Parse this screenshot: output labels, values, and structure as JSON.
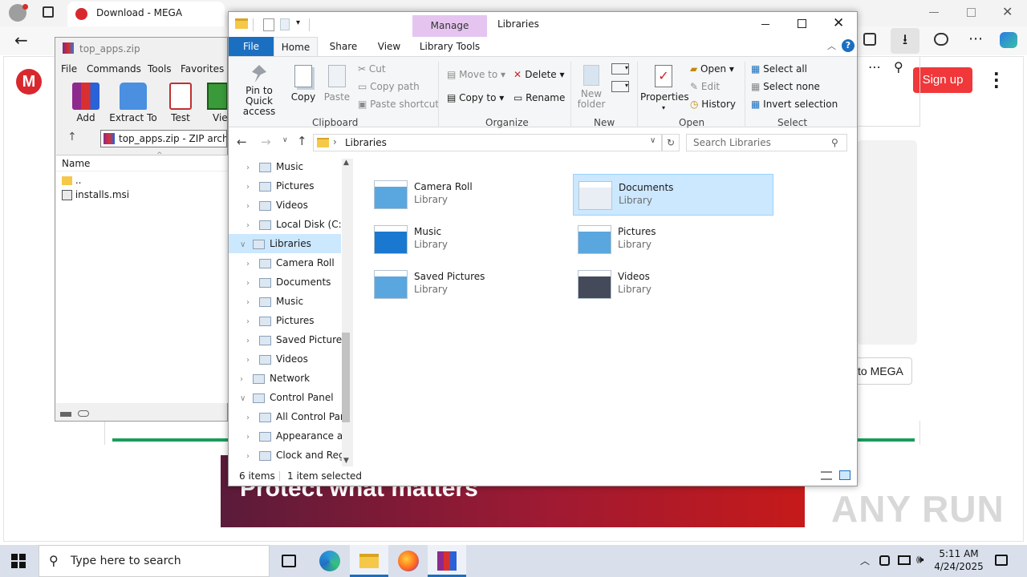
{
  "browser": {
    "tab_title": "Download - MEGA",
    "signup_label": "Sign up",
    "download_to_mega_label": "to MEGA",
    "banner_text": "Protect what matters"
  },
  "winrar": {
    "title": "top_apps.zip",
    "menu": [
      "File",
      "Commands",
      "Tools",
      "Favorites"
    ],
    "toolbar": [
      "Add",
      "Extract To",
      "Test",
      "View"
    ],
    "path": "top_apps.zip - ZIP archive",
    "column_name": "Name",
    "files": [
      "..",
      "installs.msi"
    ]
  },
  "explorer": {
    "title": "Libraries",
    "manage_label": "Manage",
    "tabs": [
      "File",
      "Home",
      "Share",
      "View",
      "Library Tools"
    ],
    "ribbon": {
      "clipboard": {
        "label": "Clipboard",
        "pin_label": "Pin to Quick access",
        "copy_label": "Copy",
        "paste_label": "Paste",
        "cut_label": "Cut",
        "copy_path_label": "Copy path",
        "paste_shortcut_label": "Paste shortcut"
      },
      "organize": {
        "label": "Organize",
        "move_to_label": "Move to",
        "copy_to_label": "Copy to",
        "delete_label": "Delete",
        "rename_label": "Rename"
      },
      "new": {
        "label": "New",
        "new_folder_label": "New folder"
      },
      "open": {
        "label": "Open",
        "properties_label": "Properties",
        "open_label": "Open",
        "edit_label": "Edit",
        "history_label": "History"
      },
      "select": {
        "label": "Select",
        "select_all_label": "Select all",
        "select_none_label": "Select none",
        "invert_label": "Invert selection"
      }
    },
    "address": "Libraries",
    "search_placeholder": "Search Libraries",
    "nav": [
      {
        "label": "Music",
        "indent": 2
      },
      {
        "label": "Pictures",
        "indent": 2
      },
      {
        "label": "Videos",
        "indent": 2
      },
      {
        "label": "Local Disk (C:)",
        "indent": 2
      },
      {
        "label": "Libraries",
        "indent": 1,
        "selected": true
      },
      {
        "label": "Camera Roll",
        "indent": 2
      },
      {
        "label": "Documents",
        "indent": 2
      },
      {
        "label": "Music",
        "indent": 2
      },
      {
        "label": "Pictures",
        "indent": 2
      },
      {
        "label": "Saved Pictures",
        "indent": 2
      },
      {
        "label": "Videos",
        "indent": 2
      },
      {
        "label": "Network",
        "indent": 1
      },
      {
        "label": "Control Panel",
        "indent": 1
      },
      {
        "label": "All Control Par",
        "indent": 2
      },
      {
        "label": "Appearance an",
        "indent": 2
      },
      {
        "label": "Clock and Regi",
        "indent": 2
      }
    ],
    "libraries": [
      {
        "name": "Camera Roll",
        "type": "Library"
      },
      {
        "name": "Documents",
        "type": "Library",
        "selected": true
      },
      {
        "name": "Music",
        "type": "Library"
      },
      {
        "name": "Pictures",
        "type": "Library"
      },
      {
        "name": "Saved Pictures",
        "type": "Library"
      },
      {
        "name": "Videos",
        "type": "Library"
      }
    ],
    "status_items": "6 items",
    "status_selected": "1 item selected"
  },
  "taskbar": {
    "search_placeholder": "Type here to search",
    "time": "5:11 AM",
    "date": "4/24/2025"
  },
  "watermark": "ANY RUN"
}
